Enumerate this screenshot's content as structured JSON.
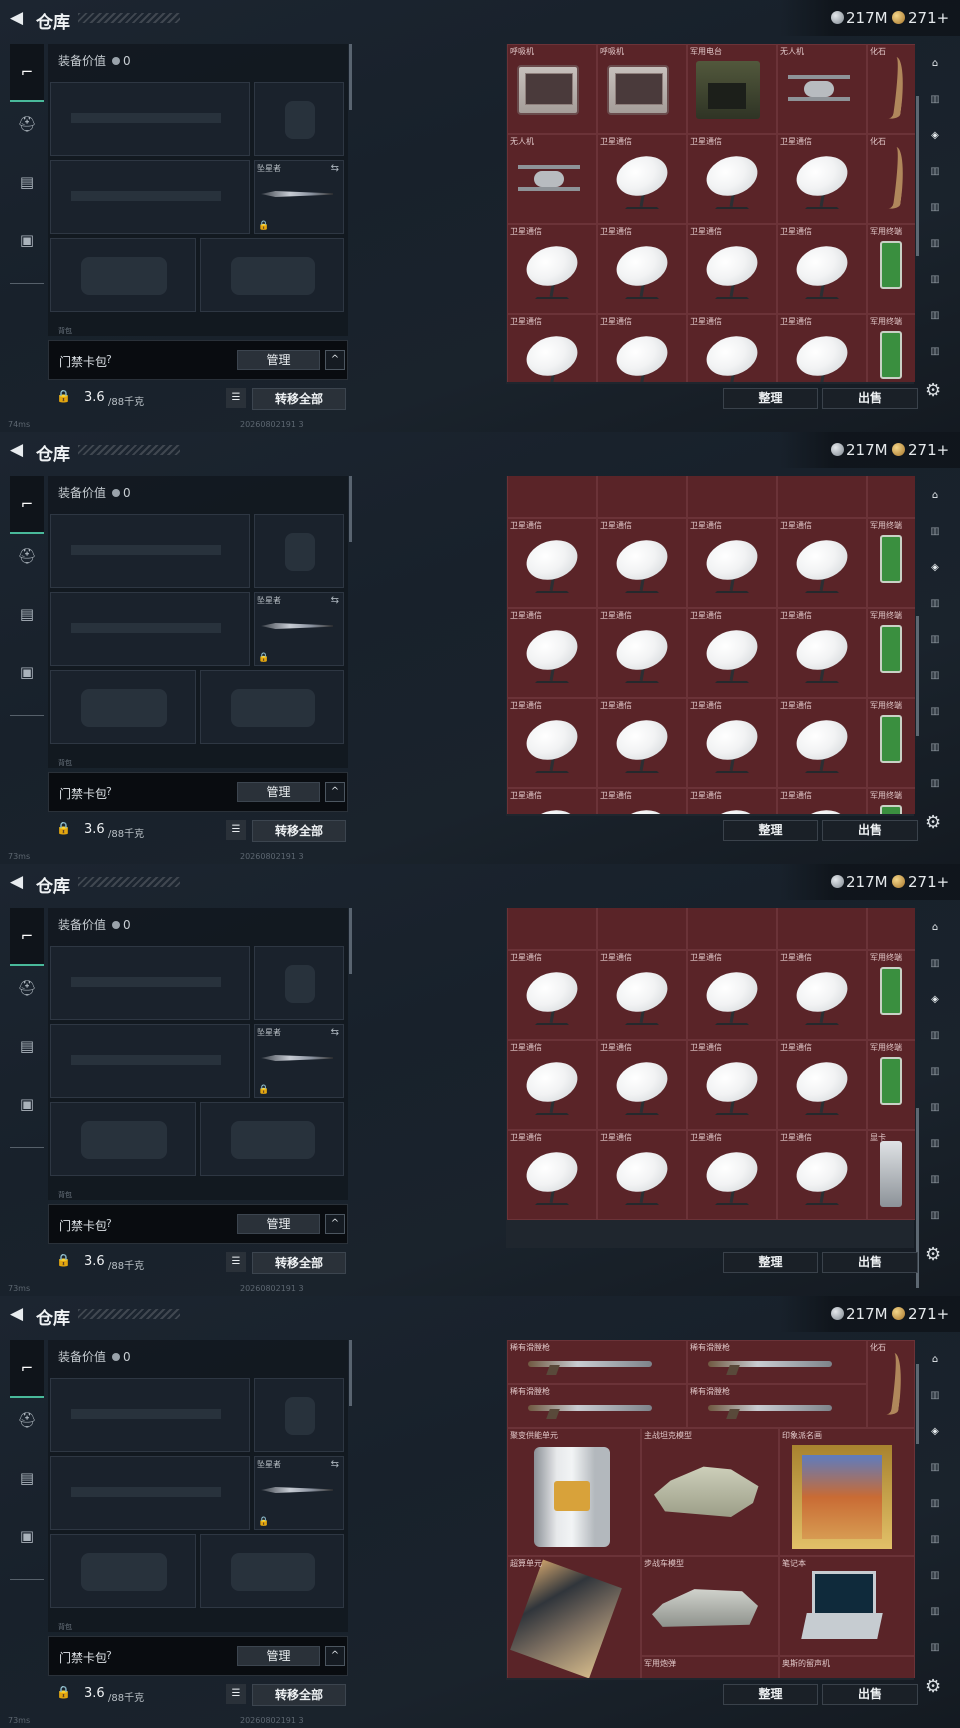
{
  "header": {
    "title": "仓库",
    "silver": "217M",
    "gold": "271+"
  },
  "left": {
    "equip_value_label": "装备价值",
    "equip_value": "0",
    "knife_tag": "坠星者",
    "sub_label": "背包",
    "gate_label": "门禁卡包",
    "gate_help": "?",
    "manage_label": "管理",
    "collapse_glyph": "^",
    "weight": "3.6",
    "weight_max": "/88千克",
    "transfer_label": "转移全部"
  },
  "right": {
    "sort_label": "整理",
    "sell_label": "出售"
  },
  "footer": {
    "pings": [
      "74ms",
      "73ms",
      "73ms",
      "73ms"
    ],
    "code": "20260802191 3"
  },
  "panels": [
    {
      "rows": [
        [
          "呼吸机",
          "呼吸机",
          "军用电台",
          "无人机",
          "化石"
        ],
        [
          "无人机",
          "卫星通信",
          "卫星通信",
          "卫星通信",
          "化石"
        ],
        [
          "卫星通信",
          "卫星通信",
          "卫星通信",
          "卫星通信",
          "军用终端"
        ],
        [
          "卫星通信",
          "卫星通信",
          "卫星通信",
          "卫星通信",
          "军用终端"
        ]
      ]
    },
    {
      "rows": [
        [
          "",
          "",
          "",
          "",
          ""
        ],
        [
          "卫星通信",
          "卫星通信",
          "卫星通信",
          "卫星通信",
          "军用终端"
        ],
        [
          "卫星通信",
          "卫星通信",
          "卫星通信",
          "卫星通信",
          "军用终端"
        ],
        [
          "卫星通信",
          "卫星通信",
          "卫星通信",
          "卫星通信",
          "军用终端"
        ],
        [
          "卫星通信",
          "卫星通信",
          "卫星通信",
          "卫星通信",
          "军用终端"
        ]
      ]
    },
    {
      "rows": [
        [
          "",
          "",
          "",
          "",
          ""
        ],
        [
          "卫星通信",
          "卫星通信",
          "卫星通信",
          "卫星通信",
          "军用终端"
        ],
        [
          "卫星通信",
          "卫星通信",
          "卫星通信",
          "卫星通信",
          "军用终端"
        ],
        [
          "卫星通信",
          "卫星通信",
          "卫星通信",
          "卫星通信",
          "显卡"
        ]
      ]
    },
    {
      "items": [
        {
          "name": "稀有滑膛枪",
          "icon": "rifle"
        },
        {
          "name": "稀有滑膛枪",
          "icon": "rifle"
        },
        {
          "name": "化石",
          "icon": "fossil"
        },
        {
          "name": "稀有滑膛枪",
          "icon": "rifle"
        },
        {
          "name": "稀有滑膛枪",
          "icon": "rifle"
        },
        {
          "name": "聚变供能单元",
          "icon": "reactor"
        },
        {
          "name": "主战坦克模型",
          "icon": "tank"
        },
        {
          "name": "印象派名画",
          "icon": "painting"
        },
        {
          "name": "超算单元",
          "icon": "board"
        },
        {
          "name": "步战车模型",
          "icon": "apc"
        },
        {
          "name": "笔记本",
          "icon": "laptop"
        },
        {
          "name": "军用炮弹",
          "icon": ""
        },
        {
          "name": "奥斯的留声机",
          "icon": ""
        }
      ]
    }
  ]
}
